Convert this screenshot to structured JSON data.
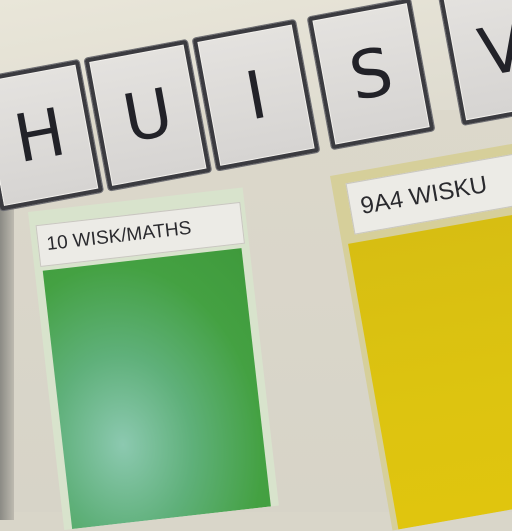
{
  "sign": {
    "letters": [
      "H",
      "U",
      "I",
      "S",
      "V"
    ]
  },
  "posters": {
    "green": {
      "label": "10 WISK/MATHS",
      "color": "#44a142"
    },
    "yellow": {
      "label": "9A4 WISKU",
      "color": "#d7be12"
    }
  },
  "colors": {
    "wall": "#d9d6c9",
    "tile_border": "#3b3b40",
    "tile_face": "#e4e2df"
  }
}
